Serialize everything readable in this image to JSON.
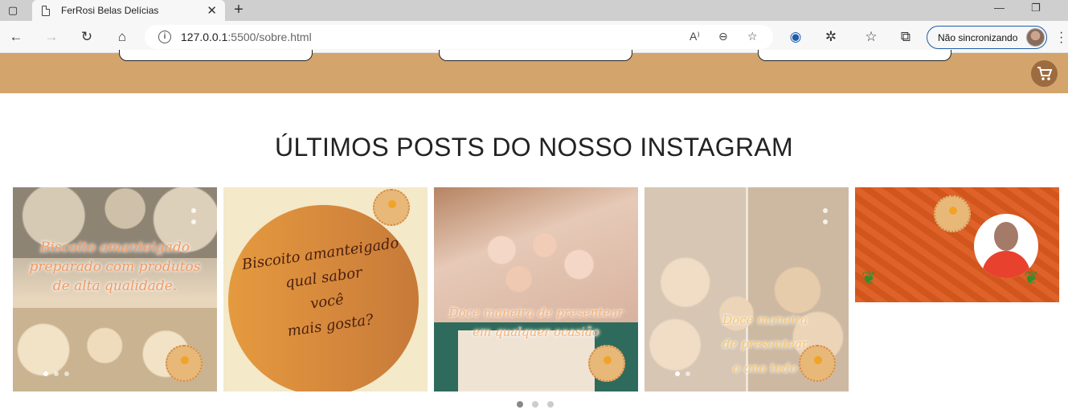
{
  "browser": {
    "tab_title": "FerRosi Belas Delícias",
    "url_host": "127.0.0.1",
    "url_path": ":5500/sobre.html",
    "sync_label": "Não sincronizando",
    "reader_icon_label": "A⁾"
  },
  "section": {
    "title": "ÚLTIMOS POSTS DO NOSSO INSTAGRAM"
  },
  "posts": [
    {
      "caption": "Biscoito amanteigado\npreparado com produtos\nde alta qualidade."
    },
    {
      "caption": "Biscoito amanteigado\nqual sabor\nvocê\nmais gosta?"
    },
    {
      "caption": "Doce maneira de presentear\nem qualquer ocasião"
    },
    {
      "caption": "Doce maneira\nde presentear\no ano todo"
    },
    {
      "caption": ""
    }
  ],
  "carousel": {
    "pages": 3,
    "active": 1
  },
  "colors": {
    "header_band": "#d3a46c",
    "cart_button": "#9c6b3f",
    "accent_orange": "#dc5a1e"
  }
}
